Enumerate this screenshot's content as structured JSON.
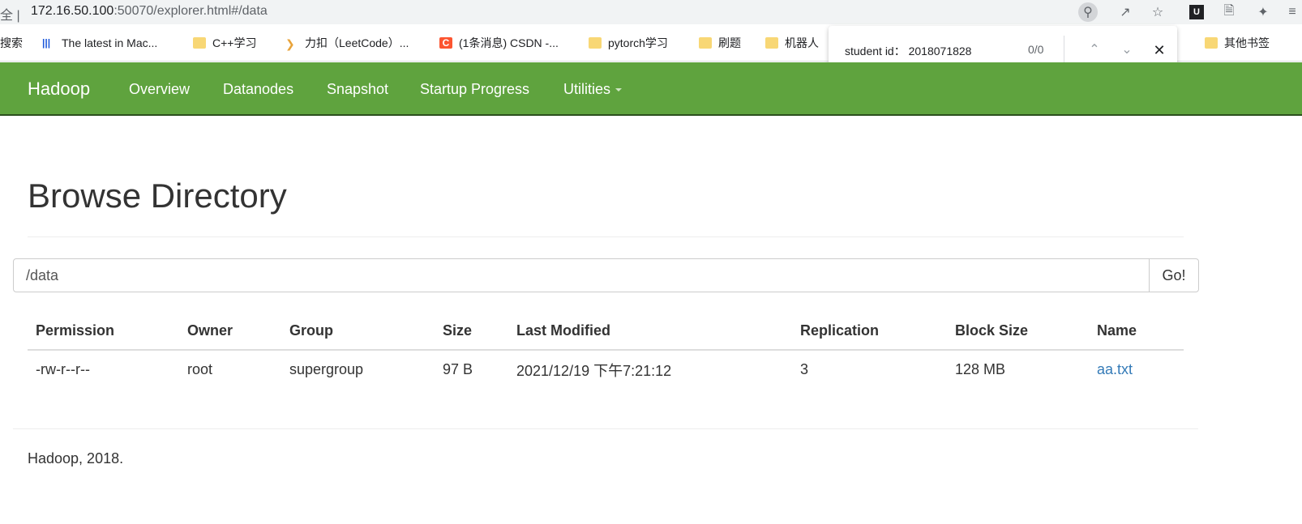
{
  "browser": {
    "address_prefix": "全 |",
    "url_host": "172.16.50.100",
    "url_rest": ":50070/explorer.html#/data",
    "icons": [
      "zoom-icon",
      "share-icon",
      "star-icon",
      "extension-u-icon",
      "document-icon",
      "puzzle-icon",
      "reading-list-icon"
    ],
    "bookmarks": [
      {
        "label": "搜索",
        "icon": "none"
      },
      {
        "label": "The latest in Mac...",
        "icon": "barcode-icon"
      },
      {
        "label": "C++学习",
        "icon": "folder-icon"
      },
      {
        "label": "力扣（LeetCode）...",
        "icon": "leetcode-icon"
      },
      {
        "label": "(1条消息) CSDN -...",
        "icon": "csdn-icon"
      },
      {
        "label": "pytorch学习",
        "icon": "folder-icon"
      },
      {
        "label": "刷题",
        "icon": "folder-icon"
      },
      {
        "label": "机器人",
        "icon": "folder-icon"
      },
      {
        "label": "其他书签",
        "icon": "folder-icon"
      }
    ],
    "find_bar": {
      "query": "student id： 2018071828",
      "count": "0/0"
    }
  },
  "navbar": {
    "brand": "Hadoop",
    "items": [
      "Overview",
      "Datanodes",
      "Snapshot",
      "Startup Progress",
      "Utilities"
    ],
    "color": "#5fa33e"
  },
  "main": {
    "title": "Browse Directory",
    "path_value": "/data",
    "go_label": "Go!",
    "table": {
      "headers": [
        "Permission",
        "Owner",
        "Group",
        "Size",
        "Last Modified",
        "Replication",
        "Block Size",
        "Name"
      ],
      "rows": [
        [
          "-rw-r--r--",
          "root",
          "supergroup",
          "97 B",
          "2021/12/19 下午7:21:12",
          "3",
          "128 MB",
          "aa.txt"
        ]
      ]
    },
    "link_color": "#337ab7"
  },
  "footer": {
    "text": "Hadoop, 2018."
  }
}
